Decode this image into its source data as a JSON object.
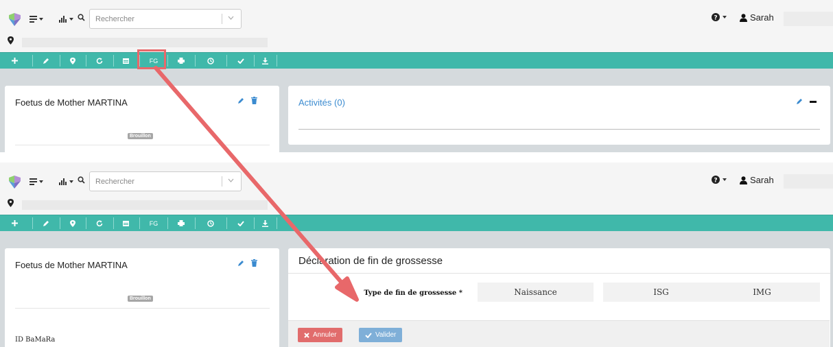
{
  "header": {
    "search_placeholder": "Rechercher",
    "user_name": "Sarah"
  },
  "toolbar": {
    "buttons": [
      {
        "icon": "plus-icon"
      },
      {
        "icon": "pencil-icon"
      },
      {
        "icon": "map-marker-icon"
      },
      {
        "icon": "refresh-icon"
      },
      {
        "icon": "calendar-icon"
      },
      {
        "label": "FG"
      },
      {
        "icon": "print-icon"
      },
      {
        "icon": "clock-icon"
      },
      {
        "icon": "check-icon"
      },
      {
        "icon": "download-icon"
      }
    ]
  },
  "patient_card": {
    "title": "Foetus de Mother MARTINA",
    "status_badge": "Brouillon",
    "id_label": "ID BaMaRa"
  },
  "activities": {
    "title": "Activités (0)"
  },
  "form": {
    "title": "Déclaration de fin de grossesse",
    "field_label": "Type de fin de grossesse *",
    "options": [
      "Naissance",
      "ISG",
      "IMG"
    ],
    "cancel_label": "Annuler",
    "submit_label": "Valider"
  },
  "colors": {
    "toolbar": "#40b8aa",
    "highlight": "#e8686a",
    "link": "#3b8bd0",
    "cancel": "#e16c6c",
    "submit": "#7fafd8"
  }
}
